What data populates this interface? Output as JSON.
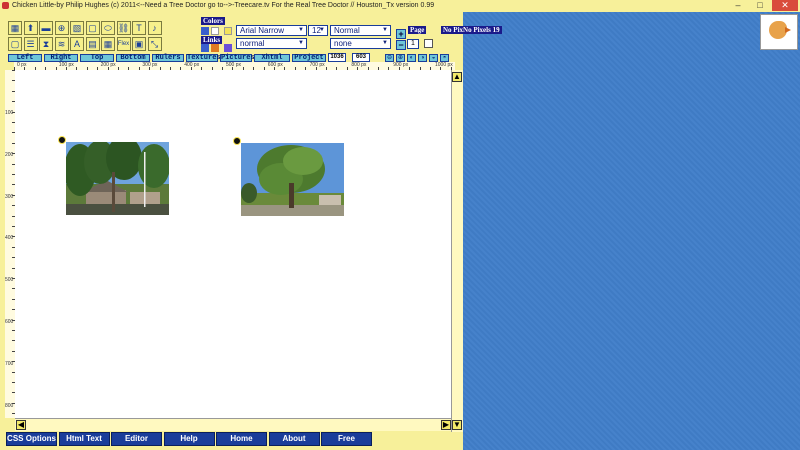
{
  "window": {
    "title": "Chicken Little-by Philip Hughes (c) 2011<--Need a Tree Doctor go to-->-Treecare.tv  For the Real Tree Doctor  //  Houston_Tx version 0.99",
    "minimize": "–",
    "maximize": "□",
    "close": "✕"
  },
  "toolbar": {
    "row1": [
      "home-icon",
      "upload-icon",
      "save-icon",
      "globe-icon",
      "image-icon",
      "box-icon",
      "shape-icon",
      "link-icon",
      "text-icon",
      "music-icon"
    ],
    "row1_glyphs": [
      "▦",
      "⬆",
      "▬",
      "⊕",
      "▧",
      "▢",
      "⬭",
      "⛓",
      "T",
      "♪"
    ],
    "row2": [
      "page-icon",
      "list-icon",
      "hourglass-icon",
      "layers-icon",
      "letter-a-icon",
      "table-icon",
      "grid-icon",
      "flex-icon",
      "frame-icon",
      "resize-icon"
    ],
    "row2_glyphs": [
      "▢",
      "☰",
      "⧗",
      "≋",
      "A",
      "▤",
      "▦",
      "Flex",
      "▣",
      "⤡"
    ]
  },
  "colors": {
    "label": "Colors",
    "swatch1": "#3a5fcc",
    "swatch2": "#ffffff",
    "swatch3": "#f2e35a"
  },
  "links": {
    "label": "Links",
    "swatch1": "#3a5fcc",
    "swatch2": "#e07a20",
    "swatch3": "#6a4fd8"
  },
  "font": {
    "family": "Arial Narrow",
    "size": "12",
    "weight": "Normal",
    "style": "normal",
    "decoration": "none"
  },
  "page": {
    "label": "Page",
    "value": "1",
    "plus": "+",
    "minus": "−",
    "pix_label": "No PixNo Pixels 19"
  },
  "tabs": [
    "Left",
    "Right",
    "Top",
    "Bottom",
    "Rulers",
    "Textures",
    "Pictures",
    "Xhtml",
    "Project"
  ],
  "dims": {
    "width": "1036",
    "height": "603"
  },
  "mini_buttons": [
    "⊖",
    "⊕",
    "◐",
    "◑",
    "◒",
    "◓"
  ],
  "hruler_labels": [
    "0 px",
    "100 px",
    "200 px",
    "300 px",
    "400 px",
    "500 px",
    "600 px",
    "700 px",
    "800 px",
    "900 px",
    "1000 px"
  ],
  "vruler_labels": [
    "100",
    "200",
    "300",
    "400",
    "500",
    "600",
    "700",
    "800"
  ],
  "scroll": {
    "up": "▲",
    "down": "▼",
    "left": "◀",
    "right": "▶"
  },
  "bottom_nav": [
    "CSS Options",
    "Html Text",
    "Editor",
    "Help",
    "Home",
    "About",
    "Free"
  ]
}
